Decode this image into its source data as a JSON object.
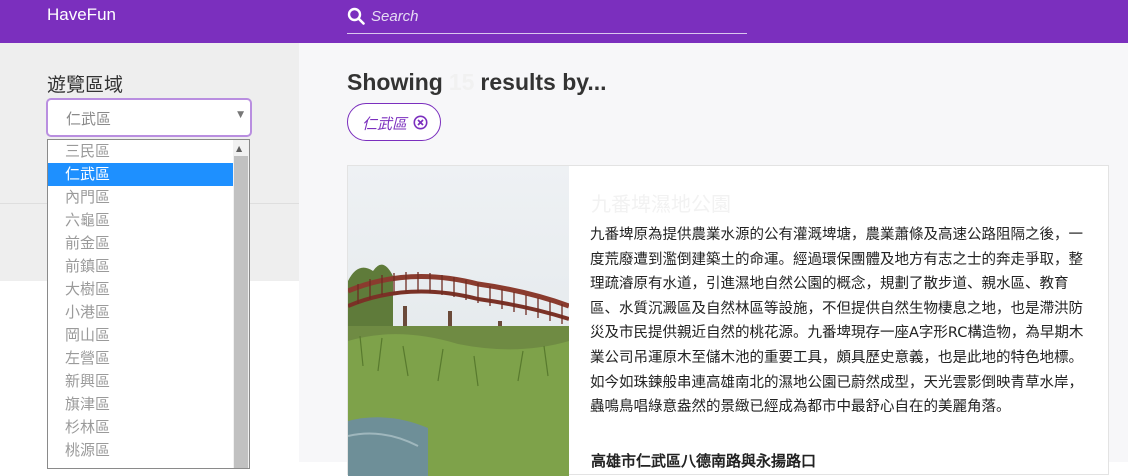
{
  "header": {
    "brand": "HaveFun",
    "search_placeholder": "Search",
    "bg_color": "#7b2fbe"
  },
  "sidebar": {
    "area_label": "遊覽區域",
    "select_value": "仁武區",
    "options": [
      {
        "label": "三民區",
        "selected": false
      },
      {
        "label": "仁武區",
        "selected": true
      },
      {
        "label": "內門區",
        "selected": false
      },
      {
        "label": "六龜區",
        "selected": false
      },
      {
        "label": "前金區",
        "selected": false
      },
      {
        "label": "前鎮區",
        "selected": false
      },
      {
        "label": "大樹區",
        "selected": false
      },
      {
        "label": "小港區",
        "selected": false
      },
      {
        "label": "岡山區",
        "selected": false
      },
      {
        "label": "左營區",
        "selected": false
      },
      {
        "label": "新興區",
        "selected": false
      },
      {
        "label": "旗津區",
        "selected": false
      },
      {
        "label": "杉林區",
        "selected": false
      },
      {
        "label": "桃源區",
        "selected": false
      }
    ]
  },
  "main": {
    "showing_prefix": "Showing",
    "result_count": "15",
    "showing_suffix": "results by...",
    "filter_chip": "仁武區",
    "card": {
      "title": "九番埤濕地公園",
      "description": "九番埤原為提供農業水源的公有灌溉埤塘，農業蕭條及高速公路阻隔之後，一度荒廢遭到濫倒建築土的命運。經過環保團體及地方有志之士的奔走爭取，整理疏濬原有水道，引進濕地自然公園的概念，規劃了散步道、親水區、教育區、水質沉澱區及自然林區等設施，不但提供自然生物棲息之地，也是滯洪防災及市民提供親近自然的桃花源。九番埤現存一座A字形RC構造物，為早期木業公司吊運原木至儲木池的重要工具，頗具歷史意義，也是此地的特色地標。如今如珠鍊般串連高雄南北的濕地公園已蔚然成型，天光雲影倒映青草水岸，蟲鳴鳥唱綠意盎然的景緻已經成為都市中最舒心自在的美麗角落。",
      "footer": "高雄市仁武區八德南路與永揚路口"
    }
  }
}
